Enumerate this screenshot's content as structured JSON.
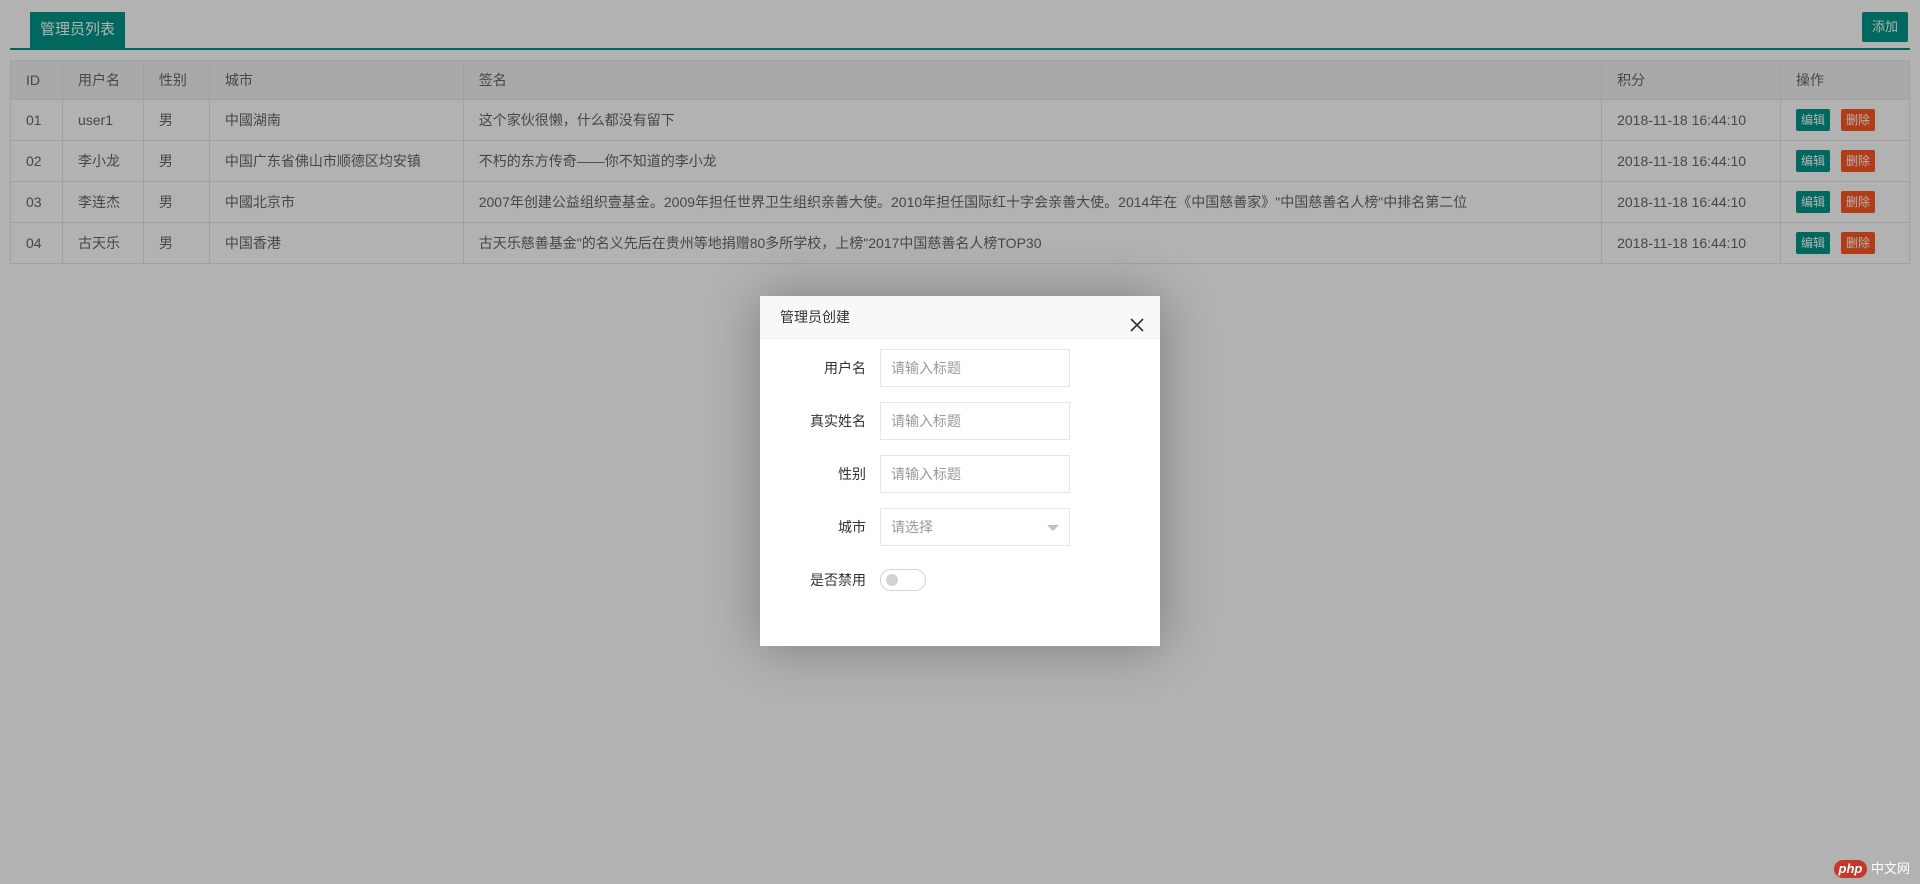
{
  "header": {
    "tab_title": "管理员列表",
    "add_label": "添加"
  },
  "table": {
    "columns": [
      "ID",
      "用户名",
      "性别",
      "城市",
      "签名",
      "积分",
      "操作"
    ],
    "rows": [
      {
        "id": "01",
        "username": "user1",
        "gender": "男",
        "city": "中國湖南",
        "signature": "这个家伙很懒，什么都没有留下",
        "score": "2018-11-18 16:44:10"
      },
      {
        "id": "02",
        "username": "李小龙",
        "gender": "男",
        "city": "中国广东省佛山市顺德区均安镇",
        "signature": "不朽的东方传奇——你不知道的李小龙",
        "score": "2018-11-18 16:44:10"
      },
      {
        "id": "03",
        "username": "李连杰",
        "gender": "男",
        "city": "中國北京市",
        "signature": "2007年创建公益组织壹基金。2009年担任世界卫生组织亲善大使。2010年担任国际红十字会亲善大使。2014年在《中国慈善家》\"中国慈善名人榜\"中排名第二位",
        "score": "2018-11-18 16:44:10"
      },
      {
        "id": "04",
        "username": "古天乐",
        "gender": "男",
        "city": "中国香港",
        "signature": "古天乐慈善基金\"的名义先后在贵州等地捐赠80多所学校，上榜\"2017中国慈善名人榜TOP30",
        "score": "2018-11-18 16:44:10"
      }
    ],
    "edit_label": "编辑",
    "delete_label": "删除"
  },
  "modal": {
    "title": "管理员创建",
    "fields": {
      "username_label": "用户名",
      "realname_label": "真实姓名",
      "gender_label": "性别",
      "city_label": "城市",
      "disabled_label": "是否禁用",
      "input_placeholder": "请输入标题",
      "select_placeholder": "请选择"
    },
    "disabled_switch_on": false
  },
  "watermark": {
    "brand": "php",
    "site": "中文网"
  },
  "colors": {
    "primary": "#009688",
    "danger": "#FF5722",
    "overlay": "rgba(0,0,0,0.3)"
  }
}
